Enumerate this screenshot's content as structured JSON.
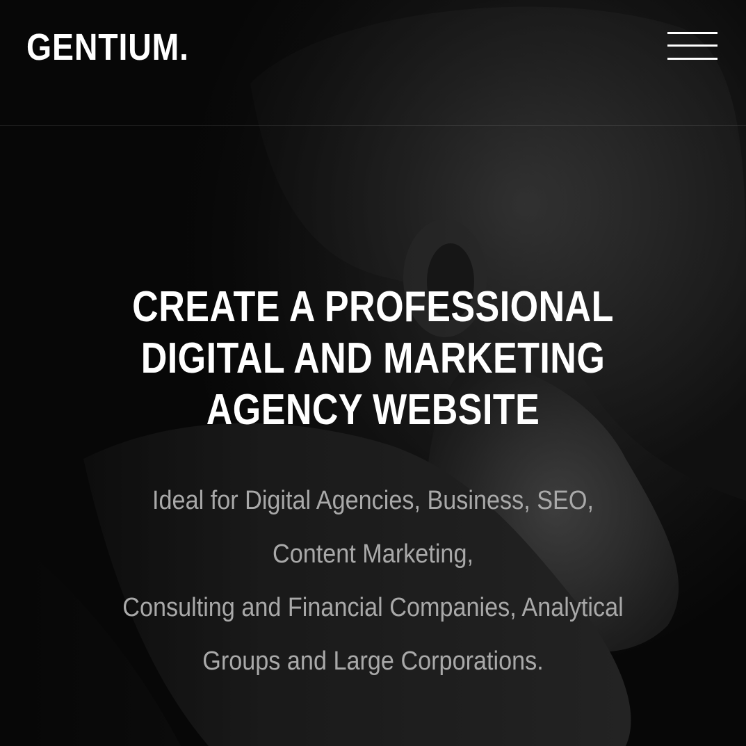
{
  "header": {
    "logo": "GENTIUM.",
    "menu_icon": "hamburger-menu-icon"
  },
  "hero": {
    "title_lines": [
      "CREATE A PROFESSIONAL",
      "DIGITAL AND MARKETING",
      "AGENCY WEBSITE"
    ],
    "subtitle_lines": [
      "Ideal for Digital Agencies, Business, SEO,",
      "Content Marketing,",
      "Consulting and Financial Companies, Analytical",
      "Groups and Large Corporations."
    ]
  },
  "colors": {
    "background": "#0e0e0e",
    "title": "#ffffff",
    "subtitle": "#a9a9a9"
  }
}
